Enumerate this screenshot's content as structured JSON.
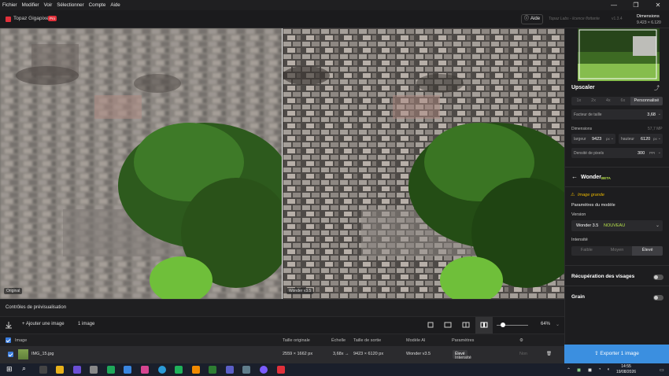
{
  "menu": [
    "Fichier",
    "Modifier",
    "Voir",
    "Sélectionner",
    "Compte",
    "Aide"
  ],
  "window_controls": [
    "—",
    "❐",
    "✕"
  ],
  "app": {
    "name": "Topaz Gigapixel",
    "badge": "Pro",
    "help_label": "Aide",
    "license": "Topaz Labs - licence flottante",
    "version": "v1.3.4"
  },
  "dimensions": {
    "label": "Dimensions",
    "value": "9.423 × 6.120"
  },
  "preview": {
    "left_label": "Original",
    "right_label": "Wonder v3.5"
  },
  "controls": {
    "title": "Contrôles de prévisualisation",
    "add_image": "Ajouter une image",
    "image_count": "1 image",
    "zoom": "64%"
  },
  "table": {
    "headers": [
      "Image",
      "Taille originale",
      "Échelle",
      "Taille de sortie",
      "Modèle AI",
      "Paramètres"
    ],
    "row": {
      "name": "IMG_15.jpg",
      "original_size": "2559 × 1662 px",
      "scale": "3,68x →",
      "output_size": "9423 × 6120 px",
      "model": "Wonder v3.5",
      "param_label": "Intensité",
      "param_value": "Élevé",
      "extra": "Non"
    }
  },
  "sidebar": {
    "upscaler_title": "Upscaler",
    "scale_options": [
      "1x",
      "2x",
      "4x",
      "6x",
      "Personnalisé"
    ],
    "scale_factor_label": "Facteur de taille",
    "scale_factor_value": "3,68",
    "dimensions_label": "Dimensions",
    "dimensions_mp": "57,7 MP",
    "width_label": "largeur",
    "width_value": "9423",
    "width_unit": "px",
    "height_label": "hauteur",
    "height_value": "6120",
    "height_unit": "px",
    "density_label": "Densité de pixels",
    "density_value": "300",
    "density_unit": "PPI",
    "model_name": "Wonder",
    "model_tag": "BETA",
    "warning": "Image grande",
    "model_params_title": "Paramètres du modèle",
    "version_label": "Version",
    "version_value": "Wonder 3.5",
    "version_tag": "NOUVEAU",
    "intensity_label": "Intensité",
    "intensity_options": [
      "Faible",
      "Moyen",
      "Élevé"
    ],
    "face_recovery": "Récupération des visages",
    "grain": "Grain",
    "export_label": "Exporter 1 image"
  },
  "taskbar": {
    "time": "14:55",
    "date": "19/08/2026"
  },
  "colors": {
    "accent": "#3b8fe0",
    "brand": "#e0303a",
    "new_tag": "#b6e04a",
    "warning": "#e6b400"
  }
}
